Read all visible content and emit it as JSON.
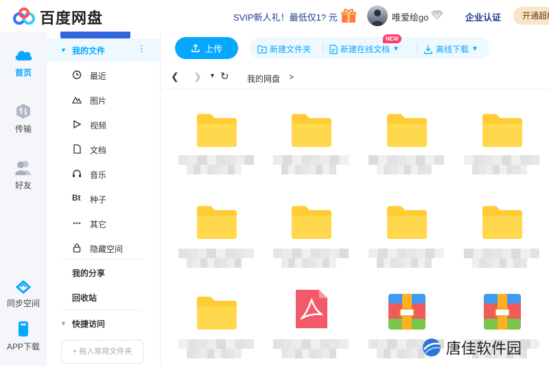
{
  "app": {
    "logo_text": "百度网盘"
  },
  "topbar": {
    "promo": "SVIP新人礼！最低仅1? 元",
    "username": "唯爱绘go",
    "enterprise": "企业认证",
    "open_vip": "开通超级"
  },
  "rail": {
    "items": [
      {
        "label": "首页",
        "icon": "cloud-icon",
        "active": true
      },
      {
        "label": "传输",
        "icon": "transfer-icon",
        "active": false
      },
      {
        "label": "好友",
        "icon": "friends-icon",
        "active": false
      },
      {
        "label": "同步空间",
        "icon": "sync-icon",
        "active": false
      },
      {
        "label": "APP下载",
        "icon": "phone-icon",
        "active": false
      }
    ]
  },
  "sidebar": {
    "my_files": "我的文件",
    "items": [
      {
        "label": "最近",
        "icon": "clock-icon"
      },
      {
        "label": "图片",
        "icon": "image-icon"
      },
      {
        "label": "视频",
        "icon": "play-icon"
      },
      {
        "label": "文档",
        "icon": "doc-icon"
      },
      {
        "label": "音乐",
        "icon": "headphones-icon"
      },
      {
        "label": "种子",
        "icon": "bt-icon"
      },
      {
        "label": "其它",
        "icon": "more-icon"
      },
      {
        "label": "隐藏空间",
        "icon": "lock-icon"
      }
    ],
    "bt_text": "Bt",
    "my_share": "我的分享",
    "recycle": "回收站",
    "quick_access": "快捷访问",
    "drop_hint": "+ 拖入常用文件夹"
  },
  "toolbar": {
    "upload": "上传",
    "new_folder": "新建文件夹",
    "new_online_doc": "新建在线文档",
    "new_badge": "NEW",
    "offline_download": "离线下载"
  },
  "breadcrumb": {
    "root": "我的网盘",
    "sep": ">"
  },
  "files": [
    {
      "type": "folder"
    },
    {
      "type": "folder"
    },
    {
      "type": "folder"
    },
    {
      "type": "folder"
    },
    {
      "type": "folder"
    },
    {
      "type": "folder"
    },
    {
      "type": "folder"
    },
    {
      "type": "folder"
    },
    {
      "type": "folder"
    },
    {
      "type": "pdf"
    },
    {
      "type": "archive"
    },
    {
      "type": "archive"
    }
  ],
  "watermark": "唐佳软件园",
  "colors": {
    "accent": "#06a7ff",
    "folder": "#ffd54f",
    "pdf": "#f25a6a"
  }
}
